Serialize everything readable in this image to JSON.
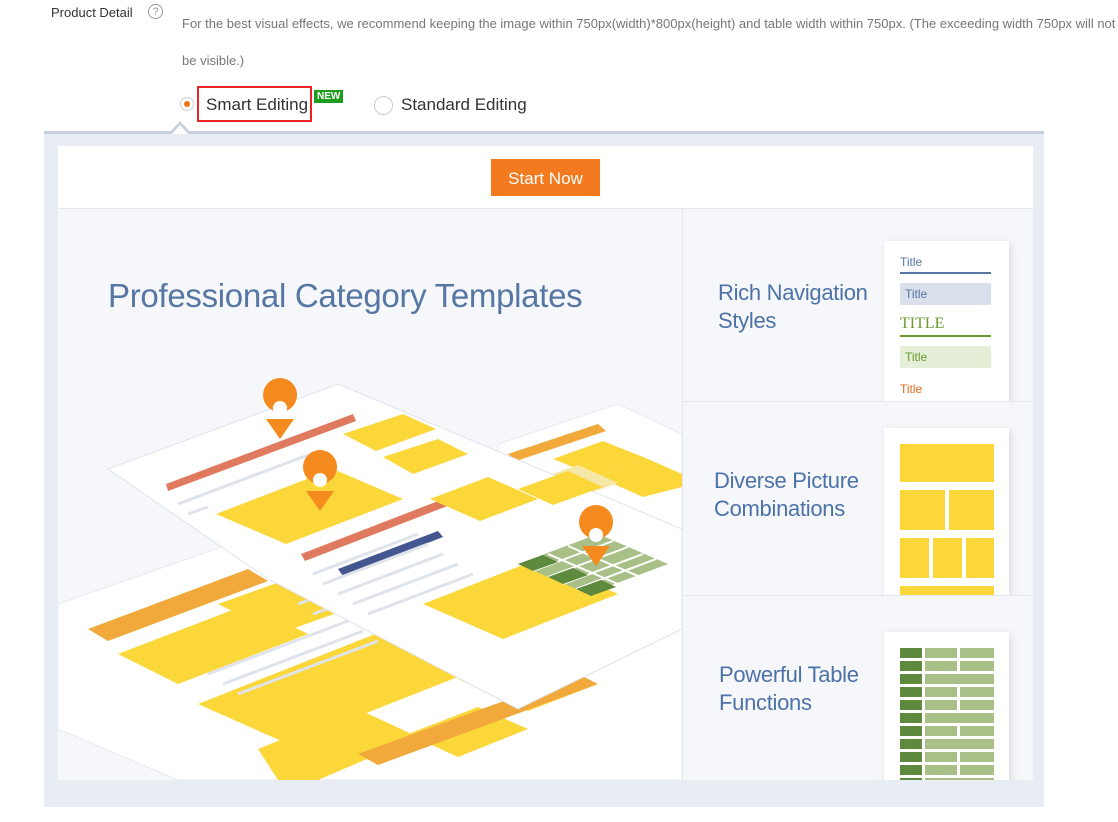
{
  "product_detail": {
    "label": "Product Detail",
    "help_icon": "?",
    "description": "For the best visual effects, we recommend keeping the image within 750px(width)*800px(height) and table width within 750px. (The exceeding width 750px will not be visible.)"
  },
  "editor_mode": {
    "options": [
      {
        "label": "Smart Editing",
        "selected": true,
        "badge": "NEW"
      },
      {
        "label": "Standard Editing",
        "selected": false
      }
    ]
  },
  "start_button": "Start Now",
  "hero": {
    "title": "Professional Category Templates"
  },
  "features": [
    {
      "title_line1": "Rich Navigation",
      "title_line2": "Styles",
      "samples": [
        "Title",
        "Title",
        "TITLE",
        "Title",
        "Title"
      ]
    },
    {
      "title_line1": "Diverse Picture",
      "title_line2": "Combinations"
    },
    {
      "title_line1": "Powerful Table",
      "title_line2": "Functions"
    }
  ],
  "colors": {
    "accent": "#f47a1f",
    "badge": "#1c9e1c",
    "heading_blue": "#5677a4",
    "yellow": "#fcd73a",
    "green": "#5d8a3c"
  }
}
